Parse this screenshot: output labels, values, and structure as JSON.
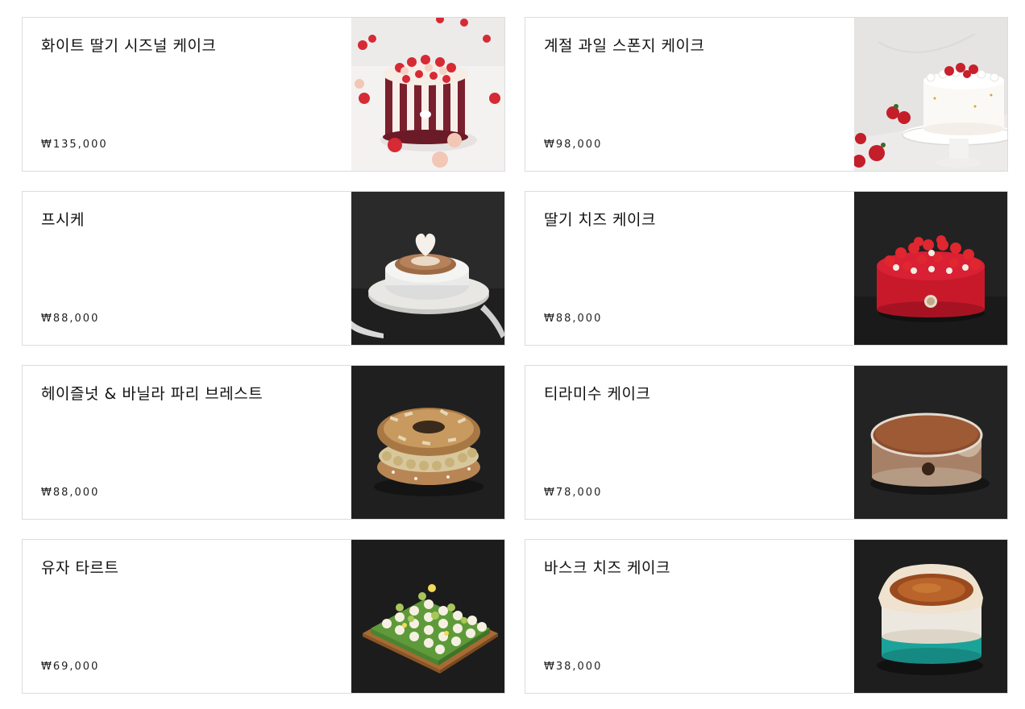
{
  "products": [
    {
      "name": "화이트 딸기 시즈널 케이크",
      "price": "₩135,000"
    },
    {
      "name": "계절 과일 스폰지 케이크",
      "price": "₩98,000"
    },
    {
      "name": "프시케",
      "price": "₩88,000"
    },
    {
      "name": "딸기 치즈 케이크",
      "price": "₩88,000"
    },
    {
      "name": "헤이즐넛 & 바닐라 파리 브레스트",
      "price": "₩88,000"
    },
    {
      "name": "티라미수 케이크",
      "price": "₩78,000"
    },
    {
      "name": "유자 타르트",
      "price": "₩69,000"
    },
    {
      "name": "바스크 치즈 케이크",
      "price": "₩38,000"
    }
  ]
}
